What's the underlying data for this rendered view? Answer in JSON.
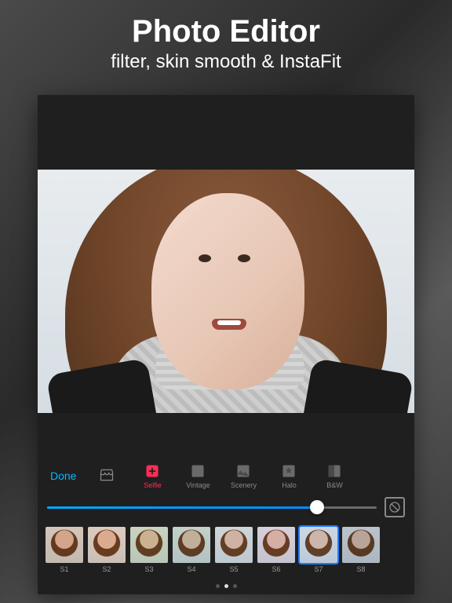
{
  "promo": {
    "title": "Photo Editor",
    "subtitle": "filter, skin smooth & InstaFit"
  },
  "toolbar": {
    "done_label": "Done",
    "categories": [
      {
        "id": "store",
        "label": "",
        "icon": "store"
      },
      {
        "id": "selfie",
        "label": "Selfie",
        "icon": "selfie",
        "active": true
      },
      {
        "id": "vintage",
        "label": "Vintage",
        "icon": "vintage"
      },
      {
        "id": "scenery",
        "label": "Scenery",
        "icon": "scenery"
      },
      {
        "id": "halo",
        "label": "Halo",
        "icon": "halo"
      },
      {
        "id": "bw",
        "label": "B&W",
        "icon": "bw"
      }
    ]
  },
  "slider": {
    "value": 82,
    "min": 0,
    "max": 100
  },
  "filters": {
    "items": [
      {
        "id": "S1",
        "tint": "#c08a5a"
      },
      {
        "id": "S2",
        "tint": "#d89a6a"
      },
      {
        "id": "S3",
        "tint": "#a0b070"
      },
      {
        "id": "S4",
        "tint": "#88a890"
      },
      {
        "id": "S5",
        "tint": "#b0bac0"
      },
      {
        "id": "S6",
        "tint": "#c7a8c0"
      },
      {
        "id": "S7",
        "tint": "#a8c0dd",
        "selected": true
      },
      {
        "id": "S8",
        "tint": "#708090"
      }
    ]
  },
  "colors": {
    "accent_done": "#00b7ff",
    "accent_active": "#ff2d55",
    "selection": "#1e7bff"
  }
}
